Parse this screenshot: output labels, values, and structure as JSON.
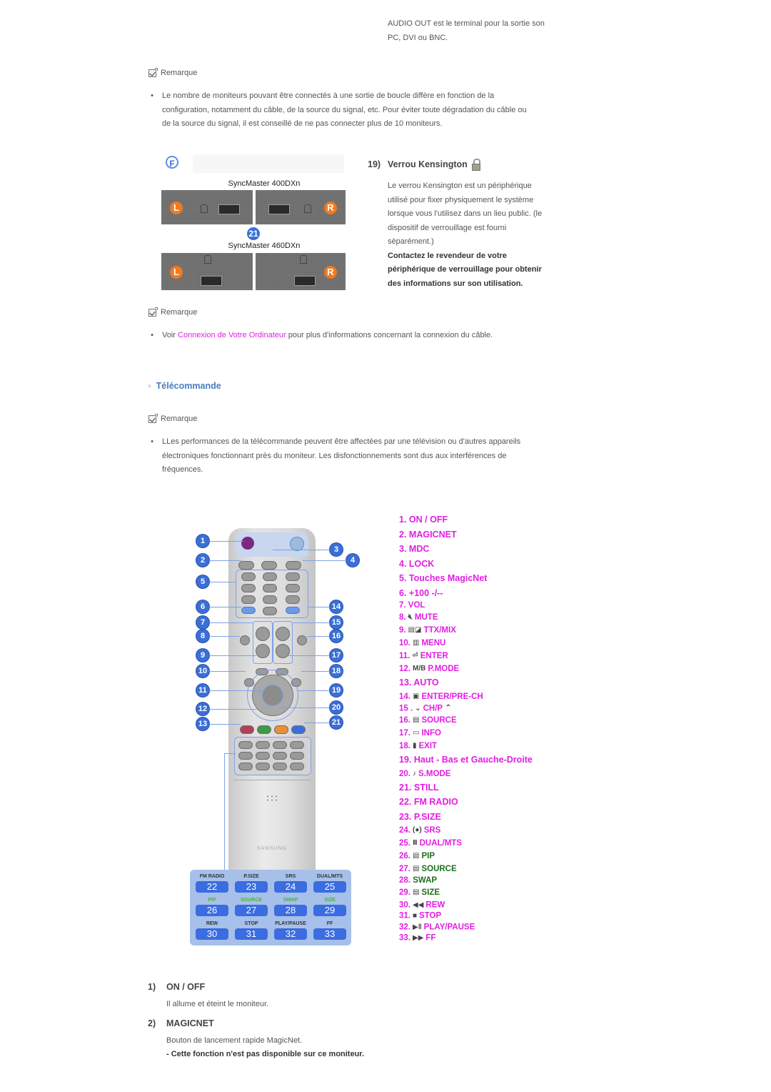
{
  "intro": {
    "audio_out_line1": "AUDIO OUT est le terminal pour la sortie son",
    "audio_out_line2": "PC, DVI ou BNC."
  },
  "note1": {
    "label": "Remarque",
    "bullet_lines": [
      "Le nombre de moniteurs pouvant être connectés à une sortie de boucle diffère en fonction de la",
      "configuration, notamment du câble, de la source du signal, etc. Pour éviter toute dégradation du câble ou",
      "de la source du signal, il est conseillé de ne pas connecter plus de 10 moniteurs."
    ]
  },
  "kensington_image": {
    "panel_letter": "F",
    "model_top": "SyncMaster 400DXn",
    "model_bottom": "SyncMaster 460DXn",
    "callout": "21",
    "left_label": "L",
    "right_label": "R"
  },
  "kensington": {
    "number": "19)",
    "title": "Verrou Kensington",
    "icon": "padlock-icon",
    "desc_lines": [
      "Le verrou Kensington est un périphérique",
      "utilisé pour fixer physiquement le système",
      "lorsque vous l'utilisez dans un lieu public. (le",
      "dispositif de verrouillage est fourni",
      "séparément.)"
    ],
    "bold_lines": [
      "Contactez le revendeur de votre",
      "périphérique de verrouillage pour obtenir",
      "des informations sur son utilisation."
    ]
  },
  "note2": {
    "label": "Remarque",
    "prefix": "Voir ",
    "link": "Connexion de Votre Ordinateur",
    "suffix": " pour plus d'informations concernant la connexion du câble."
  },
  "section": {
    "title": "Télécommande"
  },
  "note3": {
    "label": "Remarque",
    "bullet_lines": [
      "LLes performances de la télécommande peuvent être affectées par une télévision ou d'autres appareils",
      "électroniques fonctionnant près du moniteur. Les disfonctionnements sont dus aux interférences de",
      "fréquences."
    ]
  },
  "remote_legend": [
    {
      "n": "1.",
      "label": "ON / OFF"
    },
    {
      "n": "2.",
      "label": "MAGICNET"
    },
    {
      "n": "3.",
      "label": "MDC"
    },
    {
      "n": "4.",
      "label": "LOCK"
    },
    {
      "n": "5.",
      "label": "Touches MagicNet"
    },
    {
      "n": "6.",
      "label": "+100 -/--"
    },
    {
      "n": "7.",
      "label": "VOL"
    },
    {
      "n": "8.",
      "label": "MUTE",
      "icon": "mute-icon"
    },
    {
      "n": "9.",
      "label": "TTX/MIX",
      "icon": "teletext-icon"
    },
    {
      "n": "10.",
      "label": "MENU",
      "icon": "menu-icon"
    },
    {
      "n": "11.",
      "label": "ENTER",
      "icon": "enter-icon"
    },
    {
      "n": "12.",
      "label": "P.MODE",
      "icon": "mb-icon",
      "icon_text": "M/B"
    },
    {
      "n": "13.",
      "label": "AUTO"
    },
    {
      "n": "14.",
      "label": "ENTER/PRE-CH",
      "icon": "pre-ch-icon"
    },
    {
      "n": "15 .",
      "label": "CH/P",
      "icon": "chevron-down-icon",
      "icon_after": "chevron-up-icon"
    },
    {
      "n": "16.",
      "label": "SOURCE",
      "icon": "source-icon"
    },
    {
      "n": "17.",
      "label": "INFO",
      "icon": "info-icon"
    },
    {
      "n": "18.",
      "label": "EXIT",
      "icon": "exit-icon"
    },
    {
      "n": "19.",
      "label": "Haut - Bas et Gauche-Droite"
    },
    {
      "n": "20.",
      "label": "S.MODE",
      "icon": "sound-mode-icon"
    },
    {
      "n": "21.",
      "label": "STILL"
    },
    {
      "n": "22.",
      "label": "FM RADIO"
    },
    {
      "n": "23.",
      "label": "P.SIZE"
    },
    {
      "n": "24.",
      "label": "SRS",
      "icon": "srs-icon"
    },
    {
      "n": "25.",
      "label": "DUAL/MTS",
      "icon": "dual-icon"
    },
    {
      "n": "26.",
      "label": "PIP",
      "icon": "pip-icon",
      "color": "green"
    },
    {
      "n": "27.",
      "label": "SOURCE",
      "icon": "pip-source-icon",
      "color": "green"
    },
    {
      "n": "28.",
      "label": "SWAP",
      "color": "green"
    },
    {
      "n": "29.",
      "label": "SIZE",
      "icon": "pip-size-icon",
      "color": "green"
    },
    {
      "n": "30.",
      "label": "REW",
      "icon": "rewind-icon"
    },
    {
      "n": "31.",
      "label": "STOP",
      "icon": "stop-icon"
    },
    {
      "n": "32.",
      "label": "PLAY/PAUSE",
      "icon": "play-pause-icon"
    },
    {
      "n": "33.",
      "label": "FF",
      "icon": "fast-forward-icon"
    }
  ],
  "remote_image": {
    "brand": "SAMSUNG",
    "callouts_left": [
      "1",
      "2",
      "5",
      "6",
      "7",
      "8",
      "9",
      "10",
      "11",
      "12",
      "13"
    ],
    "callouts_right": [
      "3",
      "4",
      "14",
      "15",
      "16",
      "17",
      "18",
      "19",
      "20",
      "21"
    ],
    "grid": [
      {
        "label": "FM RADIO",
        "num": "22"
      },
      {
        "label": "P.SIZE",
        "num": "23"
      },
      {
        "label": "SRS",
        "num": "24"
      },
      {
        "label": "DUAL/MTS",
        "num": "25"
      },
      {
        "label": "PIP",
        "num": "26",
        "green": true
      },
      {
        "label": "SOURCE",
        "num": "27",
        "green": true
      },
      {
        "label": "SWAP",
        "num": "28",
        "green": true
      },
      {
        "label": "SIZE",
        "num": "29",
        "green": true
      },
      {
        "label": "REW",
        "num": "30"
      },
      {
        "label": "STOP",
        "num": "31"
      },
      {
        "label": "PLAY/PAUSE",
        "num": "32"
      },
      {
        "label": "FF",
        "num": "33"
      }
    ]
  },
  "details": [
    {
      "num": "1)",
      "title": "ON / OFF",
      "lines": [
        "Il allume et éteint le moniteur."
      ],
      "bold": ""
    },
    {
      "num": "2)",
      "title": "MAGICNET",
      "lines": [
        "Bouton de lancement rapide MagicNet."
      ],
      "bold": "- Cette fonction n'est pas disponible sur ce moniteur."
    }
  ],
  "colors": {
    "link": "#e020e0",
    "legend": "#e31de3",
    "legend_green": "#1f6e1f",
    "section_heading": "#4a7cc0",
    "callout_blue": "#3a6fd8"
  }
}
